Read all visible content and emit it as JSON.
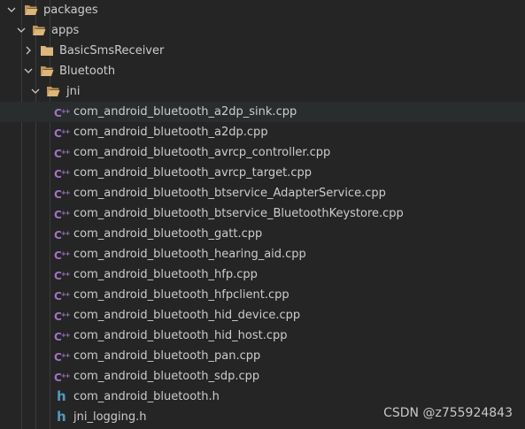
{
  "tree": {
    "packages_label": "packages",
    "apps_label": "apps",
    "basicsms_label": "BasicSmsReceiver",
    "bluetooth_label": "Bluetooth",
    "jni_label": "jni",
    "files": [
      {
        "name": "com_android_bluetooth_a2dp_sink.cpp",
        "type": "cpp-icon"
      },
      {
        "name": "com_android_bluetooth_a2dp.cpp",
        "type": "cpp-icon"
      },
      {
        "name": "com_android_bluetooth_avrcp_controller.cpp",
        "type": "cpp-icon"
      },
      {
        "name": "com_android_bluetooth_avrcp_target.cpp",
        "type": "cpp-icon"
      },
      {
        "name": "com_android_bluetooth_btservice_AdapterService.cpp",
        "type": "cpp-icon"
      },
      {
        "name": "com_android_bluetooth_btservice_BluetoothKeystore.cpp",
        "type": "cpp-icon"
      },
      {
        "name": "com_android_bluetooth_gatt.cpp",
        "type": "cpp-icon"
      },
      {
        "name": "com_android_bluetooth_hearing_aid.cpp",
        "type": "cpp-icon"
      },
      {
        "name": "com_android_bluetooth_hfp.cpp",
        "type": "cpp-icon"
      },
      {
        "name": "com_android_bluetooth_hfpclient.cpp",
        "type": "cpp-icon"
      },
      {
        "name": "com_android_bluetooth_hid_device.cpp",
        "type": "cpp-icon"
      },
      {
        "name": "com_android_bluetooth_hid_host.cpp",
        "type": "cpp-icon"
      },
      {
        "name": "com_android_bluetooth_pan.cpp",
        "type": "cpp-icon"
      },
      {
        "name": "com_android_bluetooth_sdp.cpp",
        "type": "cpp-icon"
      },
      {
        "name": "com_android_bluetooth.h",
        "type": "h-icon"
      },
      {
        "name": "jni_logging.h",
        "type": "h-icon"
      }
    ]
  },
  "icons": {
    "cpp_glyph": "C",
    "cpp_plus": "++",
    "h_glyph": "h"
  },
  "colors": {
    "background": "#252526",
    "hover": "#2a2d2e",
    "folder": "#dcb67a",
    "cpp": "#a074c4",
    "header": "#519aba",
    "text": "#cccccc"
  },
  "watermark": "CSDN @z755924843"
}
